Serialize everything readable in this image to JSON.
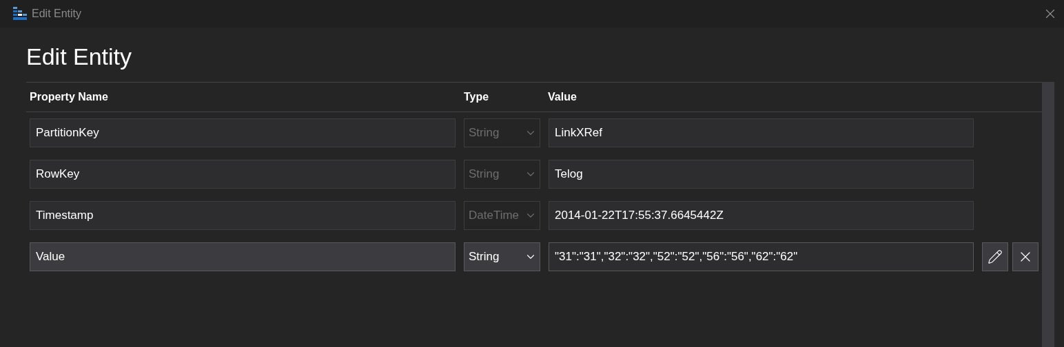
{
  "window": {
    "title": "Edit Entity"
  },
  "heading": "Edit Entity",
  "table": {
    "columns": [
      "Property Name",
      "Type",
      "Value"
    ],
    "rows": [
      {
        "name": "PartitionKey",
        "type": "String",
        "value": "LinkXRef",
        "editable": false
      },
      {
        "name": "RowKey",
        "type": "String",
        "value": "Telog",
        "editable": false
      },
      {
        "name": "Timestamp",
        "type": "DateTime",
        "value": "2014-01-22T17:55:37.6645442Z",
        "editable": false
      },
      {
        "name": "Value",
        "type": "String",
        "value": "\"31\":\"31\",\"32\":\"32\",\"52\":\"52\",\"56\":\"56\",\"62\":\"62\"",
        "editable": true
      }
    ]
  }
}
